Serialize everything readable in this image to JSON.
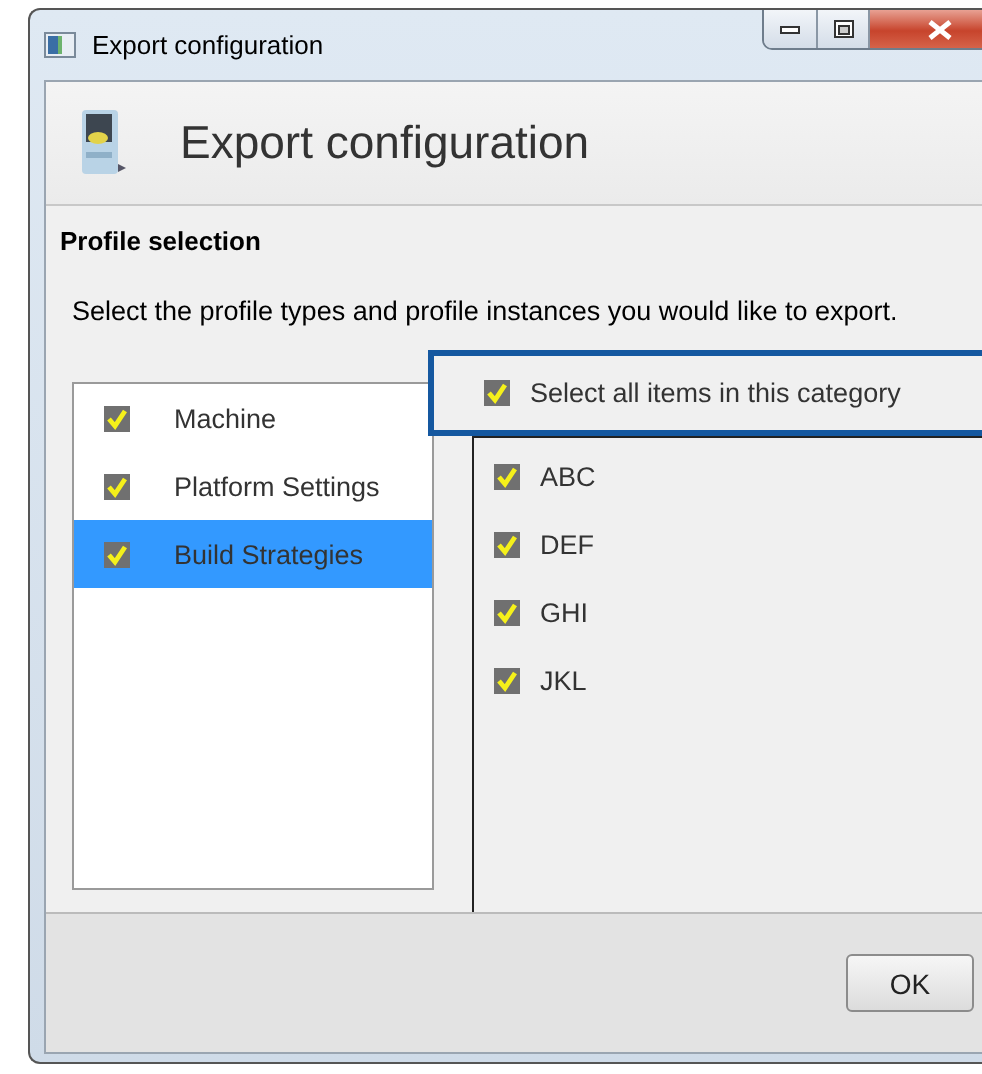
{
  "window": {
    "title": "Export configuration"
  },
  "header": {
    "title": "Export configuration"
  },
  "section": {
    "title": "Profile selection",
    "instruction": "Select the profile types and profile instances you would like to export."
  },
  "profile_types": [
    {
      "label": "Machine",
      "checked": true,
      "selected": false
    },
    {
      "label": "Platform Settings",
      "checked": true,
      "selected": false
    },
    {
      "label": "Build Strategies",
      "checked": true,
      "selected": true
    }
  ],
  "select_all": {
    "label": "Select all items in this category",
    "checked": true,
    "highlighted": true
  },
  "instances": [
    {
      "label": "ABC",
      "checked": true
    },
    {
      "label": "DEF",
      "checked": true
    },
    {
      "label": "GHI",
      "checked": true
    },
    {
      "label": "JKL",
      "checked": true
    }
  ],
  "buttons": [
    {
      "label": "OK"
    }
  ]
}
